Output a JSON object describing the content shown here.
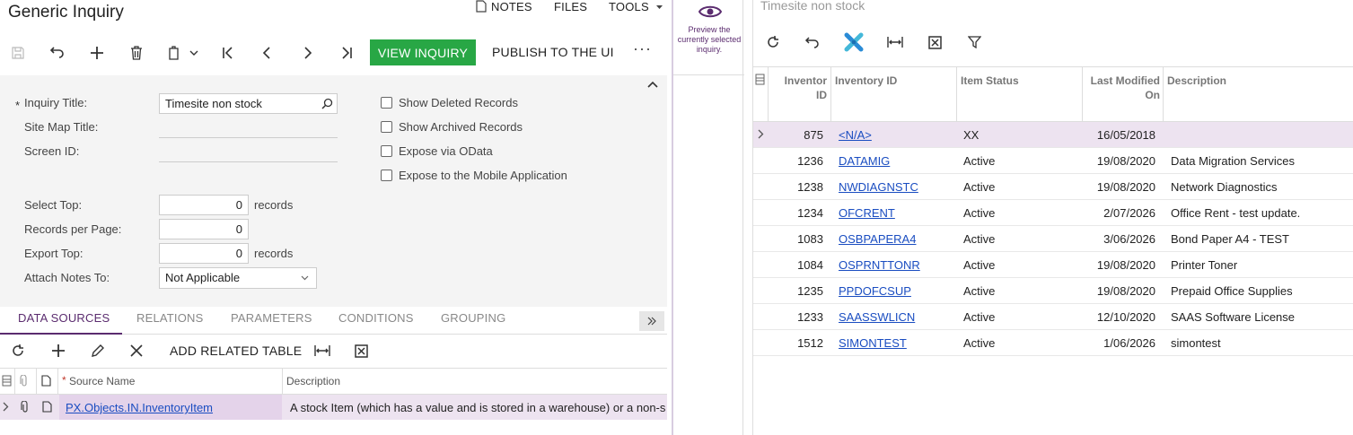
{
  "left": {
    "title": "Generic Inquiry",
    "topnav": {
      "notes": "NOTES",
      "files": "FILES",
      "tools": "TOOLS"
    },
    "toolbar": {
      "view_inquiry": "VIEW INQUIRY",
      "publish": "PUBLISH TO THE UI",
      "more": "···"
    },
    "form": {
      "inquiry_title_label": "Inquiry Title:",
      "inquiry_title_value": "Timesite non stock",
      "required_mark": "*",
      "site_map_title_label": "Site Map Title:",
      "screen_id_label": "Screen ID:",
      "select_top_label": "Select Top:",
      "select_top_value": "0",
      "records_per_page_label": "Records per Page:",
      "records_per_page_value": "0",
      "export_top_label": "Export Top:",
      "export_top_value": "0",
      "records_unit": "records",
      "attach_notes_label": "Attach Notes To:",
      "attach_notes_value": "Not Applicable",
      "show_deleted": "Show Deleted Records",
      "show_archived": "Show Archived Records",
      "expose_odata": "Expose via OData",
      "expose_mobile": "Expose to the Mobile Application"
    },
    "tabs": [
      "DATA SOURCES",
      "RELATIONS",
      "PARAMETERS",
      "CONDITIONS",
      "GROUPING"
    ],
    "ds_toolbar": {
      "add_related": "ADD RELATED TABLE"
    },
    "ds_grid": {
      "headers": {
        "source_name": "Source Name",
        "description": "Description"
      },
      "row": {
        "source_name": "PX.Objects.IN.InventoryItem",
        "description": "A stock Item (which has a value and is stored in a warehouse) or a non-s"
      }
    }
  },
  "preview": {
    "text": "Preview the currently selected inquiry."
  },
  "right": {
    "title": "Timesite non stock",
    "headers": {
      "inv_id_num": "Inventor ID",
      "inventory_id": "Inventory ID",
      "item_status": "Item Status",
      "last_modified": "Last Modified On",
      "description": "Description"
    },
    "rows": [
      {
        "num": "875",
        "id": "<N/A>",
        "status": "XX",
        "date": "16/05/2018",
        "desc": ""
      },
      {
        "num": "1236",
        "id": "DATAMIG",
        "status": "Active",
        "date": "19/08/2020",
        "desc": "Data Migration Services"
      },
      {
        "num": "1238",
        "id": "NWDIAGNSTC",
        "status": "Active",
        "date": "19/08/2020",
        "desc": "Network Diagnostics"
      },
      {
        "num": "1234",
        "id": "OFCRENT",
        "status": "Active",
        "date": "2/07/2026",
        "desc": "Office Rent - test update."
      },
      {
        "num": "1083",
        "id": "OSBPAPERA4",
        "status": "Active",
        "date": "3/06/2026",
        "desc": "Bond Paper A4 - TEST"
      },
      {
        "num": "1084",
        "id": "OSPRNTTONR",
        "status": "Active",
        "date": "19/08/2020",
        "desc": "Printer Toner"
      },
      {
        "num": "1235",
        "id": "PPDOFCSUP",
        "status": "Active",
        "date": "19/08/2020",
        "desc": "Prepaid Office Supplies"
      },
      {
        "num": "1233",
        "id": "SAASSWLICN",
        "status": "Active",
        "date": "12/10/2020",
        "desc": "SAAS Software License"
      },
      {
        "num": "1512",
        "id": "SIMONTEST",
        "status": "Active",
        "date": "1/06/2026",
        "desc": "simontest"
      }
    ]
  },
  "colors": {
    "accent": "#5b2c6f",
    "view_button": "#28a745",
    "link": "#1a4dc1",
    "selected_row": "#ede3f0"
  }
}
